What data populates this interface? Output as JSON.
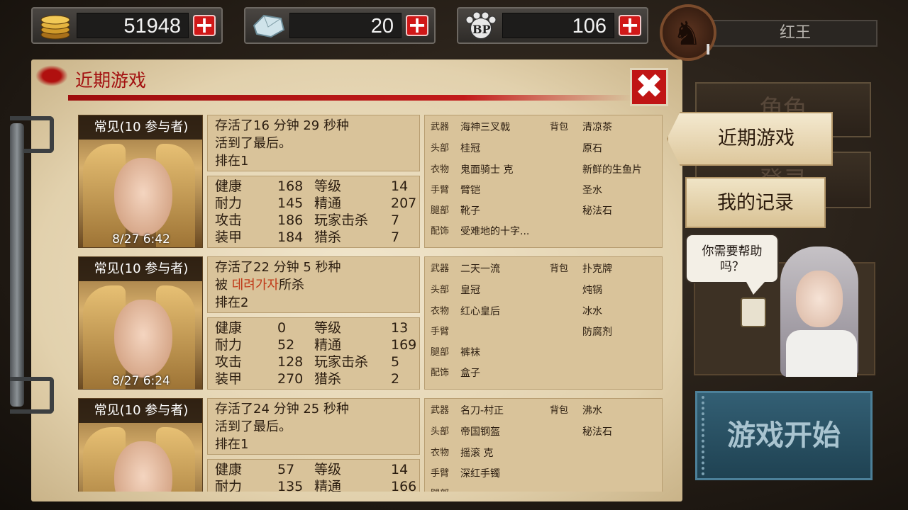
{
  "top_bar": {
    "gold": {
      "value": "51948",
      "icon": "coins-icon",
      "plus": "+"
    },
    "gems": {
      "value": "20",
      "icon": "diamond-icon",
      "plus": "+"
    },
    "bp": {
      "value": "106",
      "icon": "bp-paw-icon",
      "plus": "+"
    },
    "player": {
      "name": "红王",
      "rank": "I",
      "avatar": "horse-emblem-icon"
    }
  },
  "panel": {
    "title": "近期游戏",
    "close": "✖"
  },
  "labels": {
    "hp": "健康",
    "stamina": "耐力",
    "attack": "攻击",
    "armor": "装甲",
    "level": "等级",
    "mastery": "精通",
    "player_kills": "玩家击杀",
    "hunts": "猎杀",
    "weapon": "武器",
    "head": "头部",
    "clothes": "衣物",
    "arm": "手臂",
    "legs": "腿部",
    "accessory": "配饰",
    "bag": "背包"
  },
  "games": [
    {
      "mode": "常见(10 参与者)",
      "date": "8/27 6:42",
      "survived": "存活了16 分钟 29 秒种",
      "outcome_prefix": "活到了最后。",
      "killer": "",
      "outcome_suffix": "",
      "rank": "排在1",
      "stats": {
        "hp": "168",
        "stamina": "145",
        "attack": "186",
        "armor": "184",
        "level": "14",
        "mastery": "207",
        "player_kills": "7",
        "hunts": "7"
      },
      "gear": {
        "weapon": "海神三叉戟",
        "head": "桂冠",
        "clothes": "鬼面骑士  克",
        "arm": "臂铠",
        "legs": "靴子",
        "accessory": "受难地的十字..."
      },
      "bag": [
        "清凉茶",
        "原石",
        "新鲜的生鱼片",
        "圣水",
        "秘法石"
      ]
    },
    {
      "mode": "常见(10 参与者)",
      "date": "8/27 6:24",
      "survived": "存活了22 分钟 5 秒种",
      "outcome_prefix": "被 ",
      "killer": "데려가자",
      "outcome_suffix": "所杀",
      "rank": "排在2",
      "stats": {
        "hp": "0",
        "stamina": "52",
        "attack": "128",
        "armor": "270",
        "level": "13",
        "mastery": "169",
        "player_kills": "5",
        "hunts": "2"
      },
      "gear": {
        "weapon": "二天一流",
        "head": "皇冠",
        "clothes": "红心皇后",
        "arm": "",
        "legs": "裤袜",
        "accessory": "盒子"
      },
      "bag": [
        "扑克牌",
        "炖锅",
        "冰水",
        "防腐剂",
        ""
      ]
    },
    {
      "mode": "常见(10 参与者)",
      "date": "",
      "survived": "存活了24 分钟 25 秒种",
      "outcome_prefix": "活到了最后。",
      "killer": "",
      "outcome_suffix": "",
      "rank": "排在1",
      "stats": {
        "hp": "57",
        "stamina": "135",
        "attack": "",
        "armor": "",
        "level": "14",
        "mastery": "166",
        "player_kills": "",
        "hunts": ""
      },
      "gear": {
        "weapon": "名刀-村正",
        "head": "帝国钢盔",
        "clothes": "摇滚  克",
        "arm": "深红手镯",
        "legs": "",
        "accessory": ""
      },
      "bag": [
        "沸水",
        "秘法石",
        "",
        "",
        ""
      ]
    }
  ],
  "sidebar": {
    "ghost_tab1": "角色",
    "ghost_tab2": "登录",
    "recent_games_tab": "近期游戏",
    "my_records_tab": "我的记录",
    "help_bubble": "你需要帮助\n吗？",
    "start_button": "游戏开始"
  }
}
